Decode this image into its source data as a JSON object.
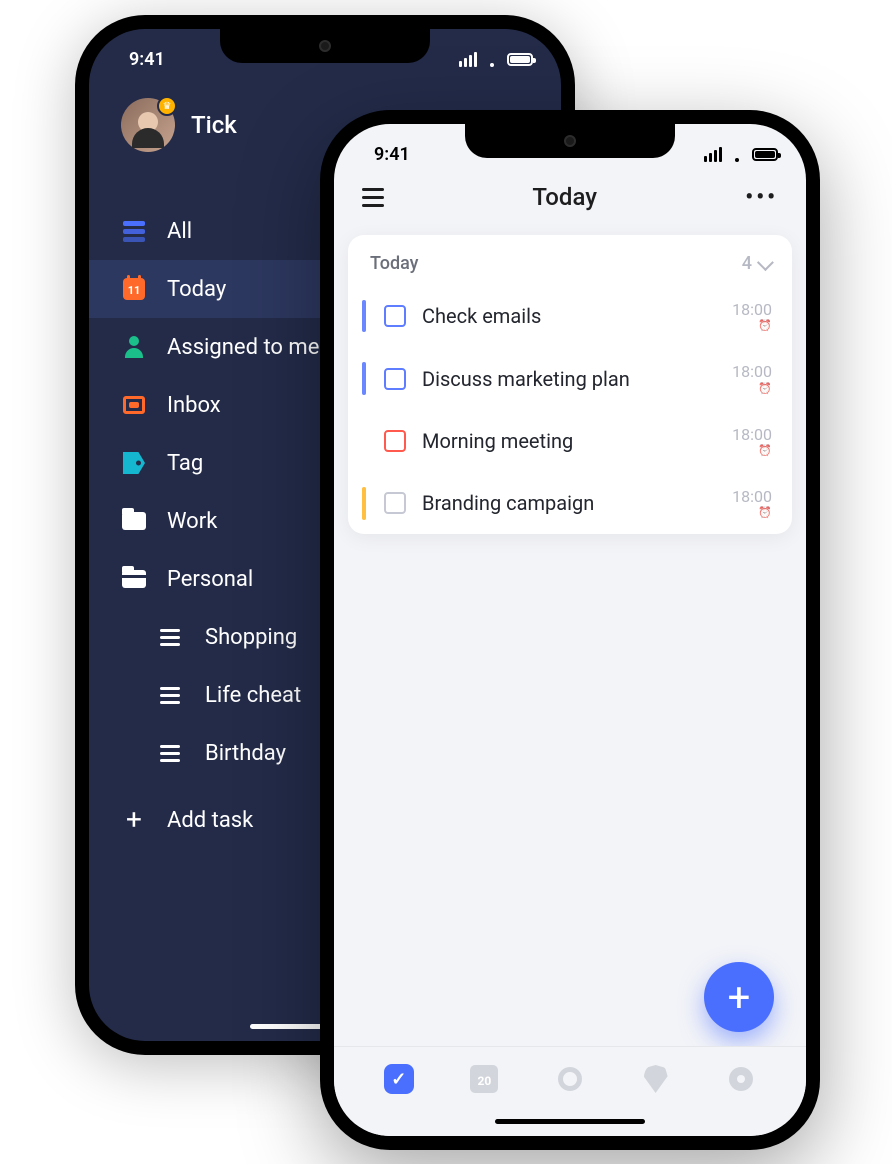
{
  "status": {
    "time": "9:41"
  },
  "phone_back": {
    "app_name": "Tick",
    "menu": {
      "all": "All",
      "today": "Today",
      "today_day": "11",
      "assigned": "Assigned to me",
      "inbox": "Inbox",
      "tag": "Tag",
      "work": "Work",
      "personal": "Personal",
      "sub": {
        "shopping": "Shopping",
        "life": "Life cheat",
        "birthday": "Birthday"
      },
      "add": "Add task"
    }
  },
  "phone_front": {
    "title": "Today",
    "section": {
      "label": "Today",
      "count": "4"
    },
    "tasks": [
      {
        "label": "Check emails",
        "time": "18:00",
        "priority": "blue",
        "chk": "blue"
      },
      {
        "label": "Discuss marketing plan",
        "time": "18:00",
        "priority": "blue",
        "chk": "blue"
      },
      {
        "label": "Morning meeting",
        "time": "18:00",
        "priority": "none",
        "chk": "red"
      },
      {
        "label": "Branding campaign",
        "time": "18:00",
        "priority": "yellow",
        "chk": "grey"
      }
    ],
    "tabbar": {
      "calendar_day": "20"
    }
  }
}
